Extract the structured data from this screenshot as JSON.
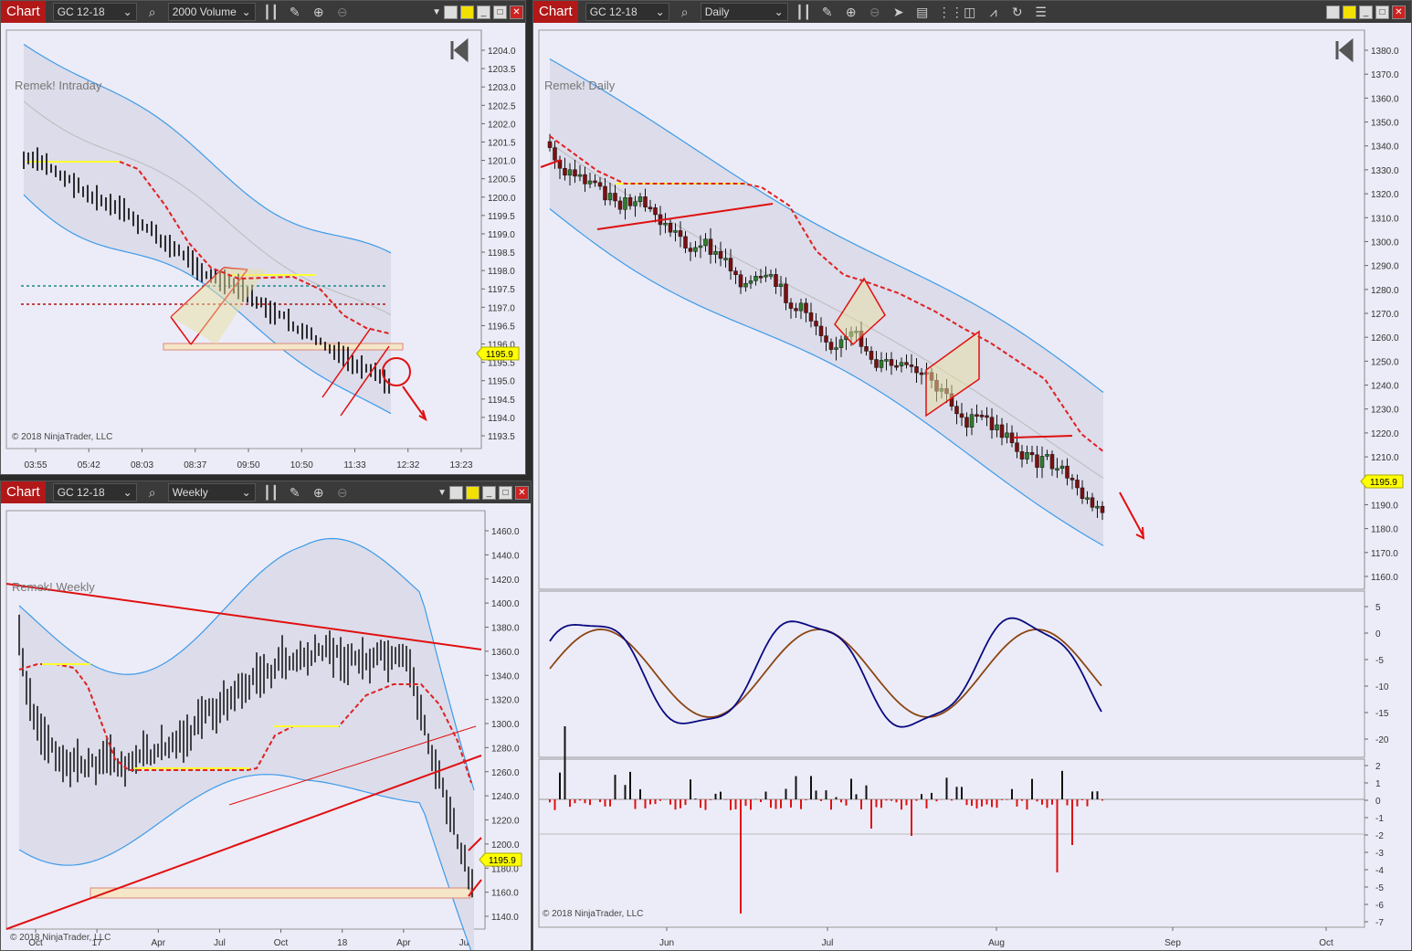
{
  "windows": [
    {
      "chart_label": "Chart",
      "instrument": "GC 12-18",
      "interval": "2000 Volume",
      "indicator_label": "Remek! Intraday",
      "copyright": "© 2018 NinjaTrader, LLC",
      "price_marker": "1195.9",
      "y_ticks": [
        "1204.0",
        "1203.5",
        "1203.0",
        "1202.5",
        "1202.0",
        "1201.5",
        "1201.0",
        "1200.5",
        "1200.0",
        "1199.5",
        "1199.0",
        "1198.5",
        "1198.0",
        "1197.5",
        "1197.0",
        "1196.5",
        "1196.0",
        "1195.5",
        "1195.0",
        "1194.5",
        "1194.0",
        "1193.5"
      ],
      "x_ticks": [
        "03:55",
        "05:42",
        "08:03",
        "08:37",
        "09:50",
        "10:50",
        "11:33",
        "12:32",
        "13:23"
      ]
    },
    {
      "chart_label": "Chart",
      "instrument": "GC 12-18",
      "interval": "Weekly",
      "indicator_label": "Remek! Weekly",
      "copyright": "© 2018 NinjaTrader, LLC",
      "price_marker": "1195.9",
      "y_ticks": [
        "1460.0",
        "1440.0",
        "1420.0",
        "1400.0",
        "1380.0",
        "1360.0",
        "1340.0",
        "1320.0",
        "1300.0",
        "1280.0",
        "1260.0",
        "1240.0",
        "1220.0",
        "1200.0",
        "1180.0",
        "1160.0",
        "1140.0"
      ],
      "x_ticks": [
        "Oct",
        "17",
        "Apr",
        "Jul",
        "Oct",
        "18",
        "Apr",
        "Jul"
      ]
    },
    {
      "chart_label": "Chart",
      "instrument": "GC 12-18",
      "interval": "Daily",
      "indicator_label": "Remek! Daily",
      "copyright": "© 2018 NinjaTrader, LLC",
      "price_marker": "1195.9",
      "y_ticks": [
        "1380.0",
        "1370.0",
        "1360.0",
        "1350.0",
        "1340.0",
        "1330.0",
        "1320.0",
        "1310.0",
        "1300.0",
        "1290.0",
        "1280.0",
        "1270.0",
        "1260.0",
        "1250.0",
        "1240.0",
        "1230.0",
        "1220.0",
        "1210.0",
        "1200.0",
        "1190.0",
        "1180.0",
        "1170.0",
        "1160.0"
      ],
      "osc_ticks": [
        "5",
        "0",
        "-5",
        "-10",
        "-15",
        "-20"
      ],
      "hist_ticks": [
        "2",
        "1",
        "0",
        "-1",
        "-2",
        "-3",
        "-4",
        "-5",
        "-6",
        "-7"
      ],
      "x_ticks": [
        "Jun",
        "Jul",
        "Aug",
        "Sep",
        "Oct"
      ]
    }
  ],
  "colors": {
    "band_fill": "#dcdcea",
    "band_line": "#3d9be9",
    "stop_line": "#e02020",
    "yellow_level": "#ffff30",
    "candle_up": "#2e7d2e",
    "candle_down": "#7a1010",
    "osc_fast": "#0a0a80",
    "osc_slow": "#8b4513",
    "hist_down": "#dd1111",
    "hist_up": "#111111",
    "marker_bg": "#ffff00"
  },
  "icons": [
    "search-icon",
    "bars-icon",
    "pencil-icon",
    "zoom-in-icon",
    "zoom-out-icon",
    "pointer-icon",
    "properties-icon",
    "strategy-icon",
    "indicators-icon",
    "tools-icon",
    "reload-icon",
    "menu-icon"
  ]
}
